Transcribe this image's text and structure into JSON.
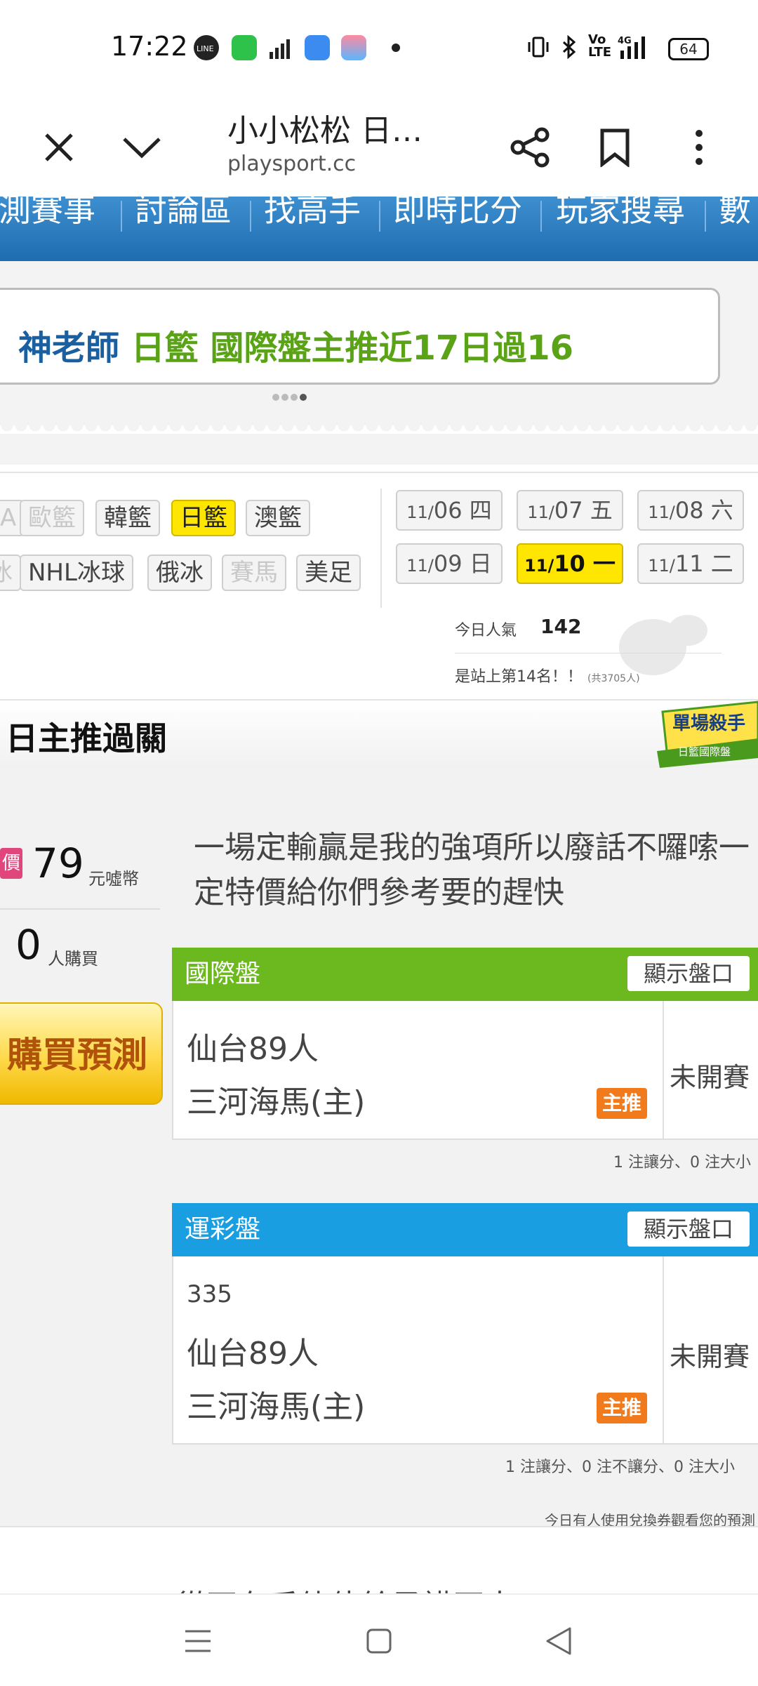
{
  "status_bar": {
    "time": "17:22",
    "battery": "64",
    "left_icons": [
      "line-app-icon",
      "messenger-app-icon",
      "signal-bars-icon",
      "app-icon",
      "game-app-icon",
      "notification-dot-icon"
    ],
    "right_icons": [
      "vibrate-icon",
      "bluetooth-icon",
      "volte-icon",
      "4g-signal-icon",
      "battery-icon"
    ]
  },
  "browser": {
    "title": "小小松松 日…",
    "url": "playsport.cc"
  },
  "site_nav": {
    "items": [
      "測賽事",
      "討論區",
      "找高手",
      "即時比分",
      "玩家搜尋",
      "數"
    ]
  },
  "banner": {
    "name": "神老師",
    "text": "日籃 國際盤主推近17日過16"
  },
  "filters": {
    "row1": [
      {
        "label": "A",
        "state": "dim"
      },
      {
        "label": "歐籃",
        "state": "dim"
      },
      {
        "label": "韓籃",
        "state": "normal"
      },
      {
        "label": "日籃",
        "state": "active"
      },
      {
        "label": "澳籃",
        "state": "normal"
      }
    ],
    "row2": [
      {
        "label": "冰",
        "state": "dim"
      },
      {
        "label": "NHL冰球",
        "state": "normal"
      },
      {
        "label": "俄冰",
        "state": "normal"
      },
      {
        "label": "賽馬",
        "state": "dim"
      },
      {
        "label": "美足",
        "state": "normal"
      }
    ]
  },
  "dates": [
    {
      "month": "11/",
      "day": "06",
      "weekday": "四",
      "active": false
    },
    {
      "month": "11/",
      "day": "07",
      "weekday": "五",
      "active": false
    },
    {
      "month": "11/",
      "day": "08",
      "weekday": "六",
      "active": false
    },
    {
      "month": "11/",
      "day": "09",
      "weekday": "日",
      "active": false
    },
    {
      "month": "11/",
      "day": "10",
      "weekday": "一",
      "active": true
    },
    {
      "month": "11/",
      "day": "11",
      "weekday": "二",
      "active": false
    }
  ],
  "popularity": {
    "label": "今日人氣",
    "value": "142",
    "rank_text": "是站上第14名！！",
    "rank_total": "(共3705人)"
  },
  "section": {
    "title": "日主推過關",
    "badge_line1": "單場殺手",
    "badge_line2": "日籃國際盤"
  },
  "purchase": {
    "price_tag": "價",
    "price": "79",
    "price_unit": "元噓幣",
    "buyers": "0",
    "buyers_unit": "人購買",
    "buy_button": "購買預測"
  },
  "description": "一場定輸贏是我的強項所以廢話不囉嗦一定特價給你們參考要的趕快",
  "panels": [
    {
      "title": "國際盤",
      "color": "#6cb81f",
      "show_button": "顯示盤口",
      "line": "",
      "away": "仙台89人",
      "home": "三河海馬(主)",
      "tag": "主推",
      "status": "未開賽",
      "note": "1 注讓分、0 注大小"
    },
    {
      "title": "運彩盤",
      "color": "#1a9ee2",
      "show_button": "顯示盤口",
      "line": "335",
      "away": "仙台89人",
      "home": "三河海馬(主)",
      "tag": "主推",
      "status": "未開賽",
      "note": "1 注讓分、0 注不讓分、0 注大小"
    }
  ],
  "coupon_note": "今日有人使用兌換券觀看您的預測",
  "cut_text": "從不在乎僥倖給予講不太"
}
